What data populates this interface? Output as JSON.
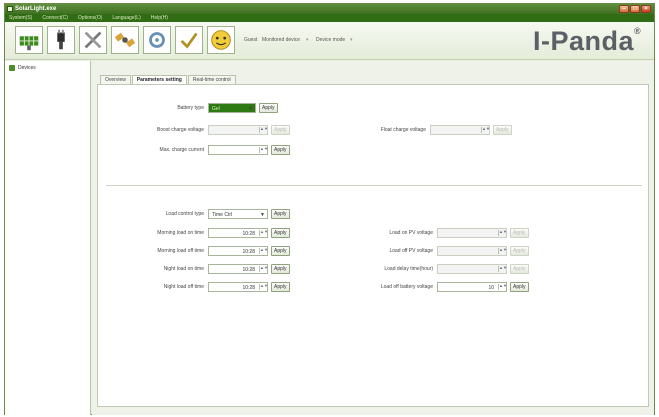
{
  "window": {
    "title": "SolarLight.exe"
  },
  "menu": [
    "System(S)",
    "Connect(C)",
    "Options(O)",
    "Language(L)",
    "Help(H)"
  ],
  "toolbar": {
    "tools": [
      "solar-panel-icon",
      "cable-icon",
      "wrench-icon",
      "satellite-icon",
      "settings-icon",
      "smiley-icon"
    ],
    "user_label": "Guest",
    "monitored_label": "Monitored device",
    "device_mode_label": "Device mode"
  },
  "brand": {
    "name": "I-Panda",
    "mark": "®"
  },
  "sidebar": {
    "items": [
      {
        "label": "Devices"
      }
    ]
  },
  "tabs": [
    "Overview",
    "Parameters setting",
    "Real-time control"
  ],
  "params": {
    "battery_type": {
      "label": "Battery type",
      "value": "Gel",
      "apply": "Apply"
    },
    "boost_voltage": {
      "label": "Boost charge voltage",
      "value": "",
      "apply": "Apply"
    },
    "float_voltage": {
      "label": "Float charge voltage",
      "value": "",
      "apply": "Apply"
    },
    "max_current": {
      "label": "Max. charge current",
      "value": "",
      "apply": "Apply"
    },
    "load_control_type": {
      "label": "Load control type",
      "value": "Time Ctrl",
      "apply": "Apply"
    },
    "morning_on": {
      "label": "Morning load on time",
      "value": "10:28",
      "apply": "Apply"
    },
    "morning_off": {
      "label": "Morning load off time",
      "value": "10:28",
      "apply": "Apply"
    },
    "night_on": {
      "label": "Night load on time",
      "value": "10:28",
      "apply": "Apply"
    },
    "night_off": {
      "label": "Night load off time",
      "value": "10:28",
      "apply": "Apply"
    },
    "load_on_pv": {
      "label": "Load on PV voltage",
      "value": "",
      "apply": "Apply"
    },
    "load_off_pv": {
      "label": "Load off PV voltage",
      "value": "",
      "apply": "Apply"
    },
    "load_delay": {
      "label": "Load delay time(hour)",
      "value": "",
      "apply": "Apply"
    },
    "load_off_batt": {
      "label": "Load off battery voltage",
      "value": "10",
      "apply": "Apply"
    }
  }
}
